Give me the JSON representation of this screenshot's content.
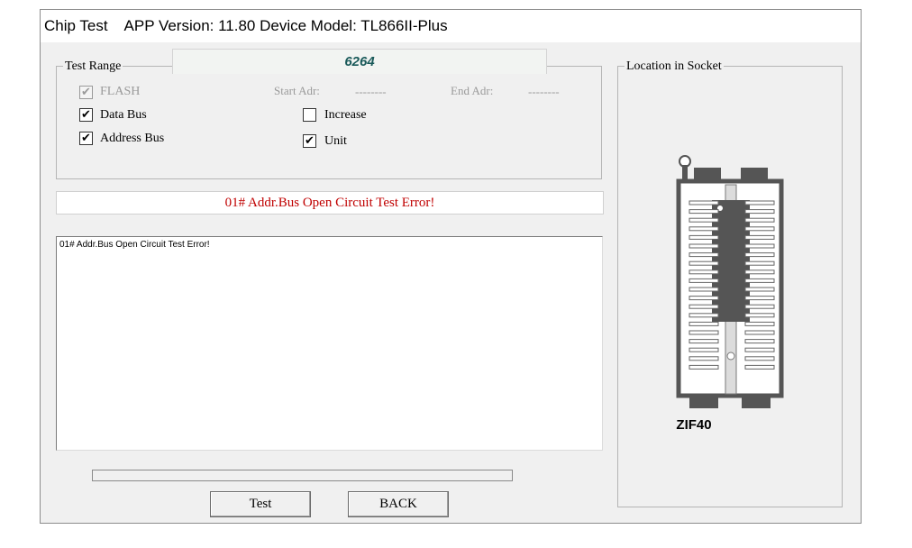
{
  "window": {
    "title": "Chip Test    APP Version: 11.80 Device Model: TL866II-Plus"
  },
  "test_range": {
    "label": "Test Range",
    "chip_name": "6264",
    "flash": {
      "label": "FLASH",
      "checked": true,
      "enabled": false
    },
    "data_bus": {
      "label": "Data Bus",
      "checked": true
    },
    "address_bus": {
      "label": "Address Bus",
      "checked": true
    },
    "increase": {
      "label": "Increase",
      "checked": false
    },
    "unit": {
      "label": "Unit",
      "checked": true
    },
    "start_adr_label": "Start Adr:",
    "start_adr_value": "--------",
    "end_adr_label": "End Adr:",
    "end_adr_value": "--------"
  },
  "status": {
    "message": "01# Addr.Bus Open Circuit Test Error!",
    "color": "#c00000"
  },
  "log": {
    "lines": [
      "01# Addr.Bus Open Circuit Test Error!"
    ]
  },
  "progress": {
    "value": 0
  },
  "buttons": {
    "test": "Test",
    "back": "BACK"
  },
  "socket": {
    "group_label": "Location in Socket",
    "socket_name": "ZIF40"
  },
  "check_mark": "✔"
}
